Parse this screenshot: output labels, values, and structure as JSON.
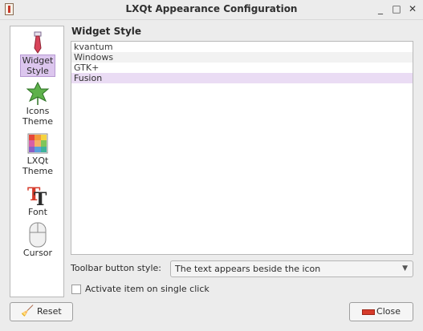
{
  "window": {
    "title": "LXQt Appearance Configuration",
    "controls": {
      "minimize": "_",
      "maximize": "□",
      "close": "✕"
    }
  },
  "sidebar": {
    "items": [
      {
        "label_line1": "Widget",
        "label_line2": "Style",
        "icon": "necktie-icon",
        "selected": true
      },
      {
        "label_line1": "Icons",
        "label_line2": "Theme",
        "icon": "ivy-leaf-icon",
        "selected": false
      },
      {
        "label_line1": "LXQt",
        "label_line2": "Theme",
        "icon": "color-palette-icon",
        "selected": false
      },
      {
        "label_line1": "Font",
        "label_line2": "",
        "icon": "font-icon",
        "selected": false
      },
      {
        "label_line1": "Cursor",
        "label_line2": "",
        "icon": "mouse-icon",
        "selected": false
      }
    ]
  },
  "main": {
    "section_title": "Widget Style",
    "styles": [
      "kvantum",
      "Windows",
      "GTK+",
      "Fusion"
    ],
    "selected_style": "Fusion",
    "toolbar_label": "Toolbar button style:",
    "toolbar_value": "The text appears beside the icon",
    "checkbox_label": "Activate item on single click",
    "checkbox_checked": false
  },
  "buttons": {
    "reset": "Reset",
    "close": "Close"
  },
  "colors": {
    "selection": "#dcc6ee",
    "accent_close": "#d63b2b"
  }
}
